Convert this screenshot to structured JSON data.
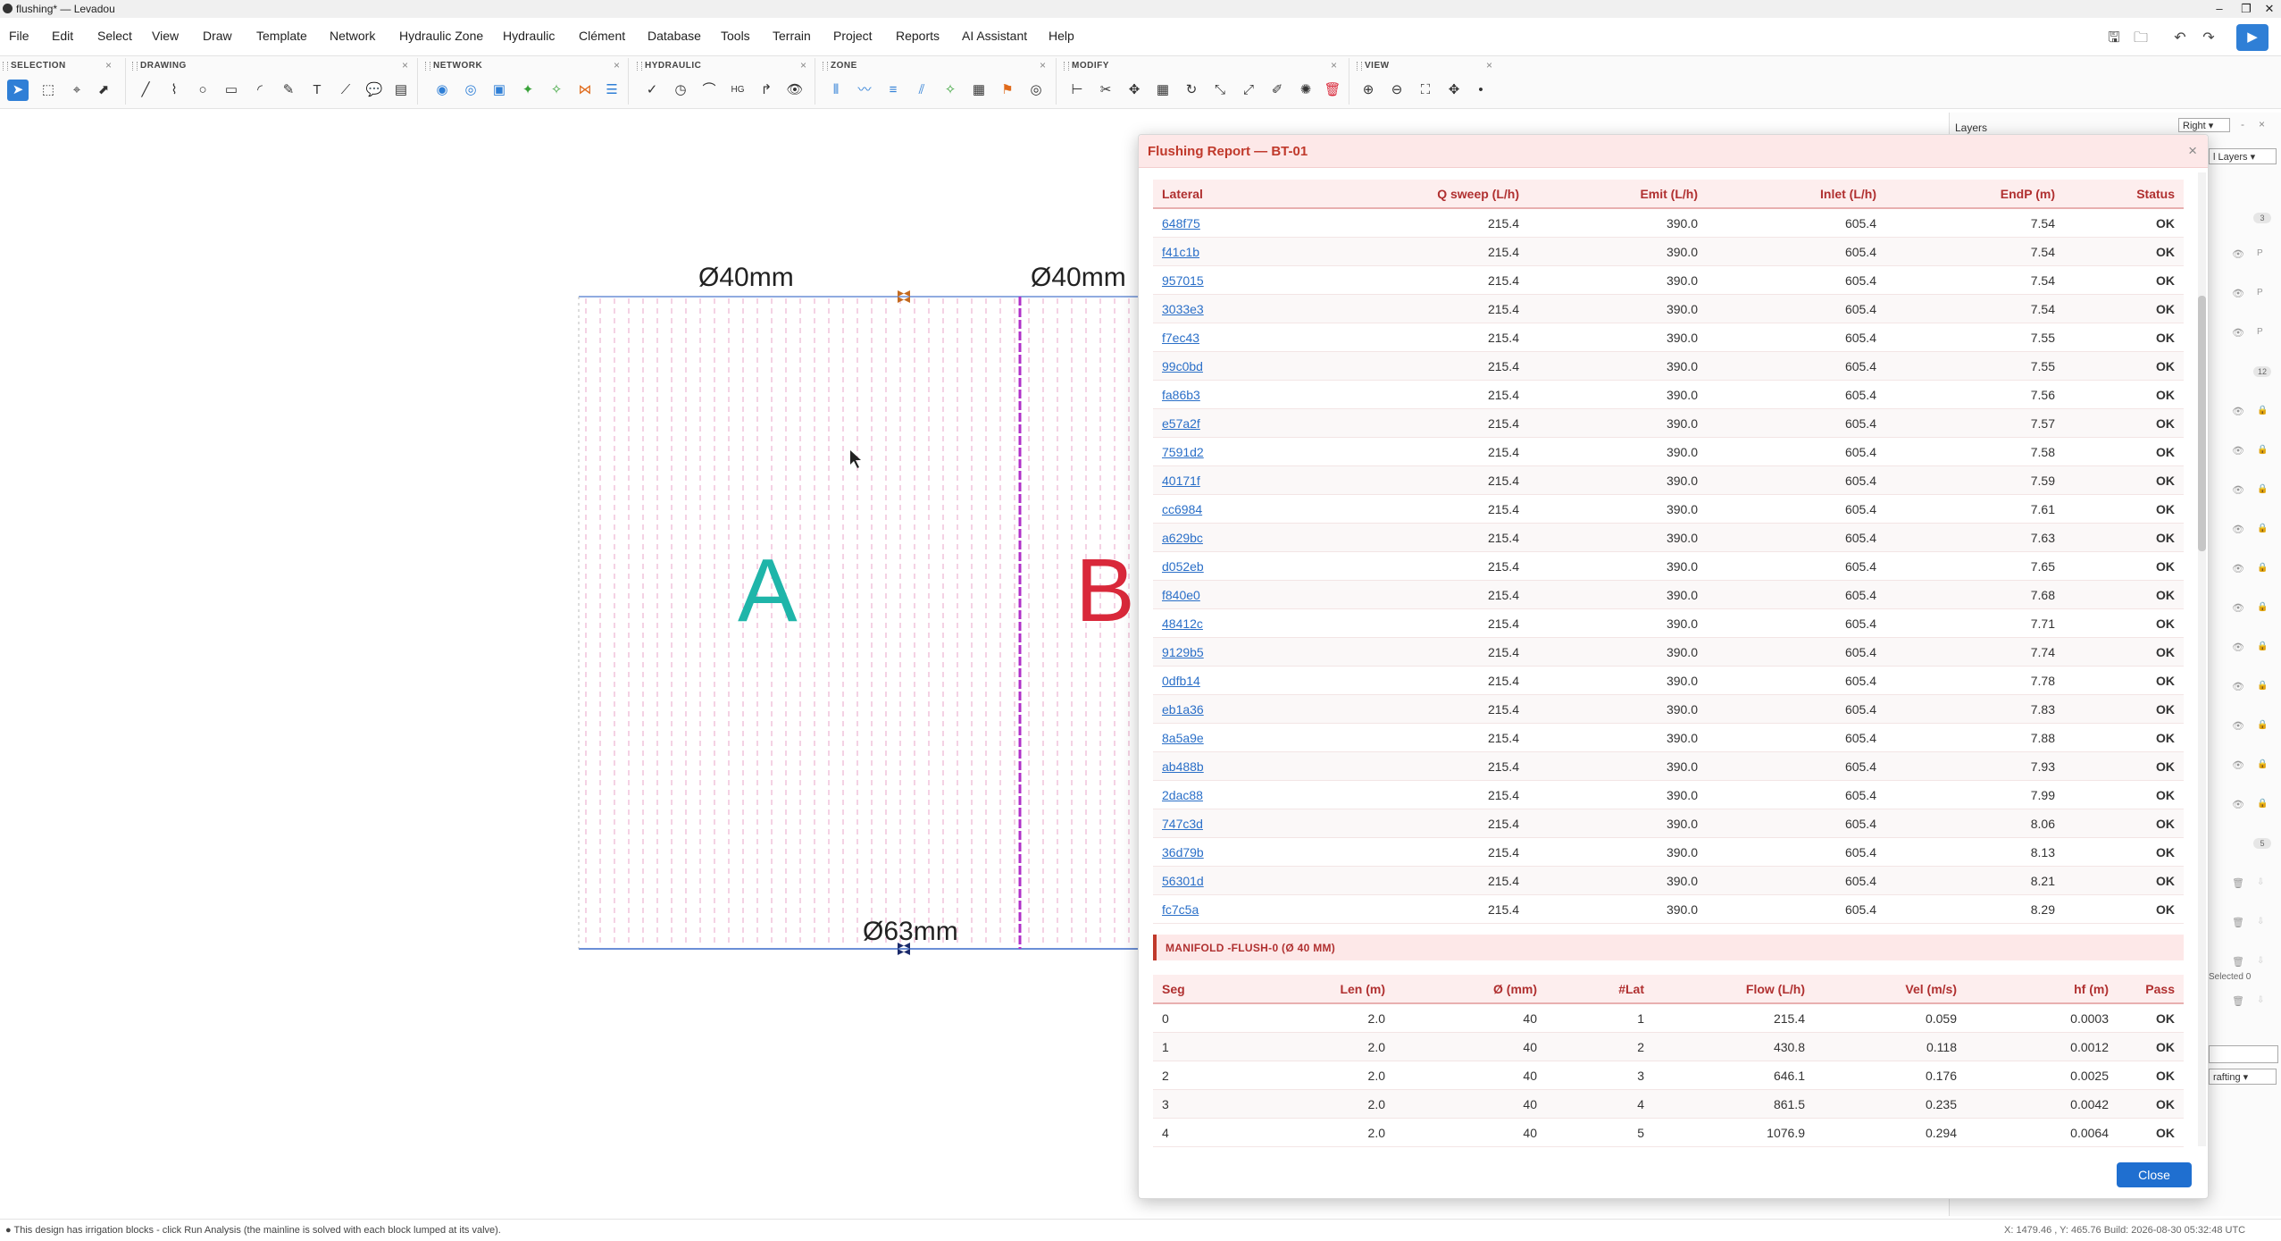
{
  "window": {
    "title": "flushing* — Levadou",
    "controls": [
      "–",
      "❐",
      "✕"
    ]
  },
  "menu": [
    "File",
    "Edit",
    "Select",
    "View",
    "Draw",
    "Template",
    "Network",
    "Hydraulic Zone",
    "Hydraulic",
    "Clément",
    "Database",
    "Tools",
    "Terrain",
    "Project",
    "Reports",
    "AI Assistant",
    "Help"
  ],
  "toolbar": {
    "groups": {
      "selection": "SELECTION",
      "drawing": "DRAWING",
      "network": "NETWORK",
      "hydraulic": "HYDRAULIC",
      "zone": "ZONE",
      "modify": "MODIFY",
      "view": "VIEW"
    }
  },
  "canvas": {
    "dim_top_left": "Ø40mm",
    "dim_top_right": "Ø40mm",
    "dim_bottom": "Ø63mm",
    "zone_a": "A",
    "zone_b": "B",
    "zone_a_color": "#1fb5a9",
    "zone_b_color": "#d9283a"
  },
  "layers_panel": {
    "title": "Layers",
    "dock_select": "Right",
    "filter_select": "l Layers",
    "badges": [
      "3",
      "12",
      "5"
    ],
    "selected_text": "Selected 0",
    "bottom_select": "rafting"
  },
  "dialog": {
    "title": "Flushing Report — BT-01",
    "close_x": "×",
    "laterals": {
      "headers": [
        "Lateral",
        "Q sweep (L/h)",
        "Emit (L/h)",
        "Inlet (L/h)",
        "EndP (m)",
        "Status"
      ],
      "rows": [
        [
          "648f75",
          "215.4",
          "390.0",
          "605.4",
          "7.54",
          "OK"
        ],
        [
          "f41c1b",
          "215.4",
          "390.0",
          "605.4",
          "7.54",
          "OK"
        ],
        [
          "957015",
          "215.4",
          "390.0",
          "605.4",
          "7.54",
          "OK"
        ],
        [
          "3033e3",
          "215.4",
          "390.0",
          "605.4",
          "7.54",
          "OK"
        ],
        [
          "f7ec43",
          "215.4",
          "390.0",
          "605.4",
          "7.55",
          "OK"
        ],
        [
          "99c0bd",
          "215.4",
          "390.0",
          "605.4",
          "7.55",
          "OK"
        ],
        [
          "fa86b3",
          "215.4",
          "390.0",
          "605.4",
          "7.56",
          "OK"
        ],
        [
          "e57a2f",
          "215.4",
          "390.0",
          "605.4",
          "7.57",
          "OK"
        ],
        [
          "7591d2",
          "215.4",
          "390.0",
          "605.4",
          "7.58",
          "OK"
        ],
        [
          "40171f",
          "215.4",
          "390.0",
          "605.4",
          "7.59",
          "OK"
        ],
        [
          "cc6984",
          "215.4",
          "390.0",
          "605.4",
          "7.61",
          "OK"
        ],
        [
          "a629bc",
          "215.4",
          "390.0",
          "605.4",
          "7.63",
          "OK"
        ],
        [
          "d052eb",
          "215.4",
          "390.0",
          "605.4",
          "7.65",
          "OK"
        ],
        [
          "f840e0",
          "215.4",
          "390.0",
          "605.4",
          "7.68",
          "OK"
        ],
        [
          "48412c",
          "215.4",
          "390.0",
          "605.4",
          "7.71",
          "OK"
        ],
        [
          "9129b5",
          "215.4",
          "390.0",
          "605.4",
          "7.74",
          "OK"
        ],
        [
          "0dfb14",
          "215.4",
          "390.0",
          "605.4",
          "7.78",
          "OK"
        ],
        [
          "eb1a36",
          "215.4",
          "390.0",
          "605.4",
          "7.83",
          "OK"
        ],
        [
          "8a5a9e",
          "215.4",
          "390.0",
          "605.4",
          "7.88",
          "OK"
        ],
        [
          "ab488b",
          "215.4",
          "390.0",
          "605.4",
          "7.93",
          "OK"
        ],
        [
          "2dac88",
          "215.4",
          "390.0",
          "605.4",
          "7.99",
          "OK"
        ],
        [
          "747c3d",
          "215.4",
          "390.0",
          "605.4",
          "8.06",
          "OK"
        ],
        [
          "36d79b",
          "215.4",
          "390.0",
          "605.4",
          "8.13",
          "OK"
        ],
        [
          "56301d",
          "215.4",
          "390.0",
          "605.4",
          "8.21",
          "OK"
        ],
        [
          "fc7c5a",
          "215.4",
          "390.0",
          "605.4",
          "8.29",
          "OK"
        ]
      ]
    },
    "manifold_title": "MANIFOLD -FLUSH-0 (Ø 40 MM)",
    "manifold": {
      "headers": [
        "Seg",
        "Len (m)",
        "Ø (mm)",
        "#Lat",
        "Flow (L/h)",
        "Vel (m/s)",
        "hf (m)",
        "Pass"
      ],
      "rows": [
        [
          "0",
          "2.0",
          "40",
          "1",
          "215.4",
          "0.059",
          "0.0003",
          "OK"
        ],
        [
          "1",
          "2.0",
          "40",
          "2",
          "430.8",
          "0.118",
          "0.0012",
          "OK"
        ],
        [
          "2",
          "2.0",
          "40",
          "3",
          "646.1",
          "0.176",
          "0.0025",
          "OK"
        ],
        [
          "3",
          "2.0",
          "40",
          "4",
          "861.5",
          "0.235",
          "0.0042",
          "OK"
        ],
        [
          "4",
          "2.0",
          "40",
          "5",
          "1076.9",
          "0.294",
          "0.0064",
          "OK"
        ]
      ]
    },
    "close_button": "Close"
  },
  "statusbar": {
    "message": "● This design has irrigation blocks - click Run Analysis (the mainline is solved with each block lumped at its valve).",
    "coords": "X: 1479.46 , Y: 465.76     Build: 2026-08-30 05:32:48 UTC"
  }
}
